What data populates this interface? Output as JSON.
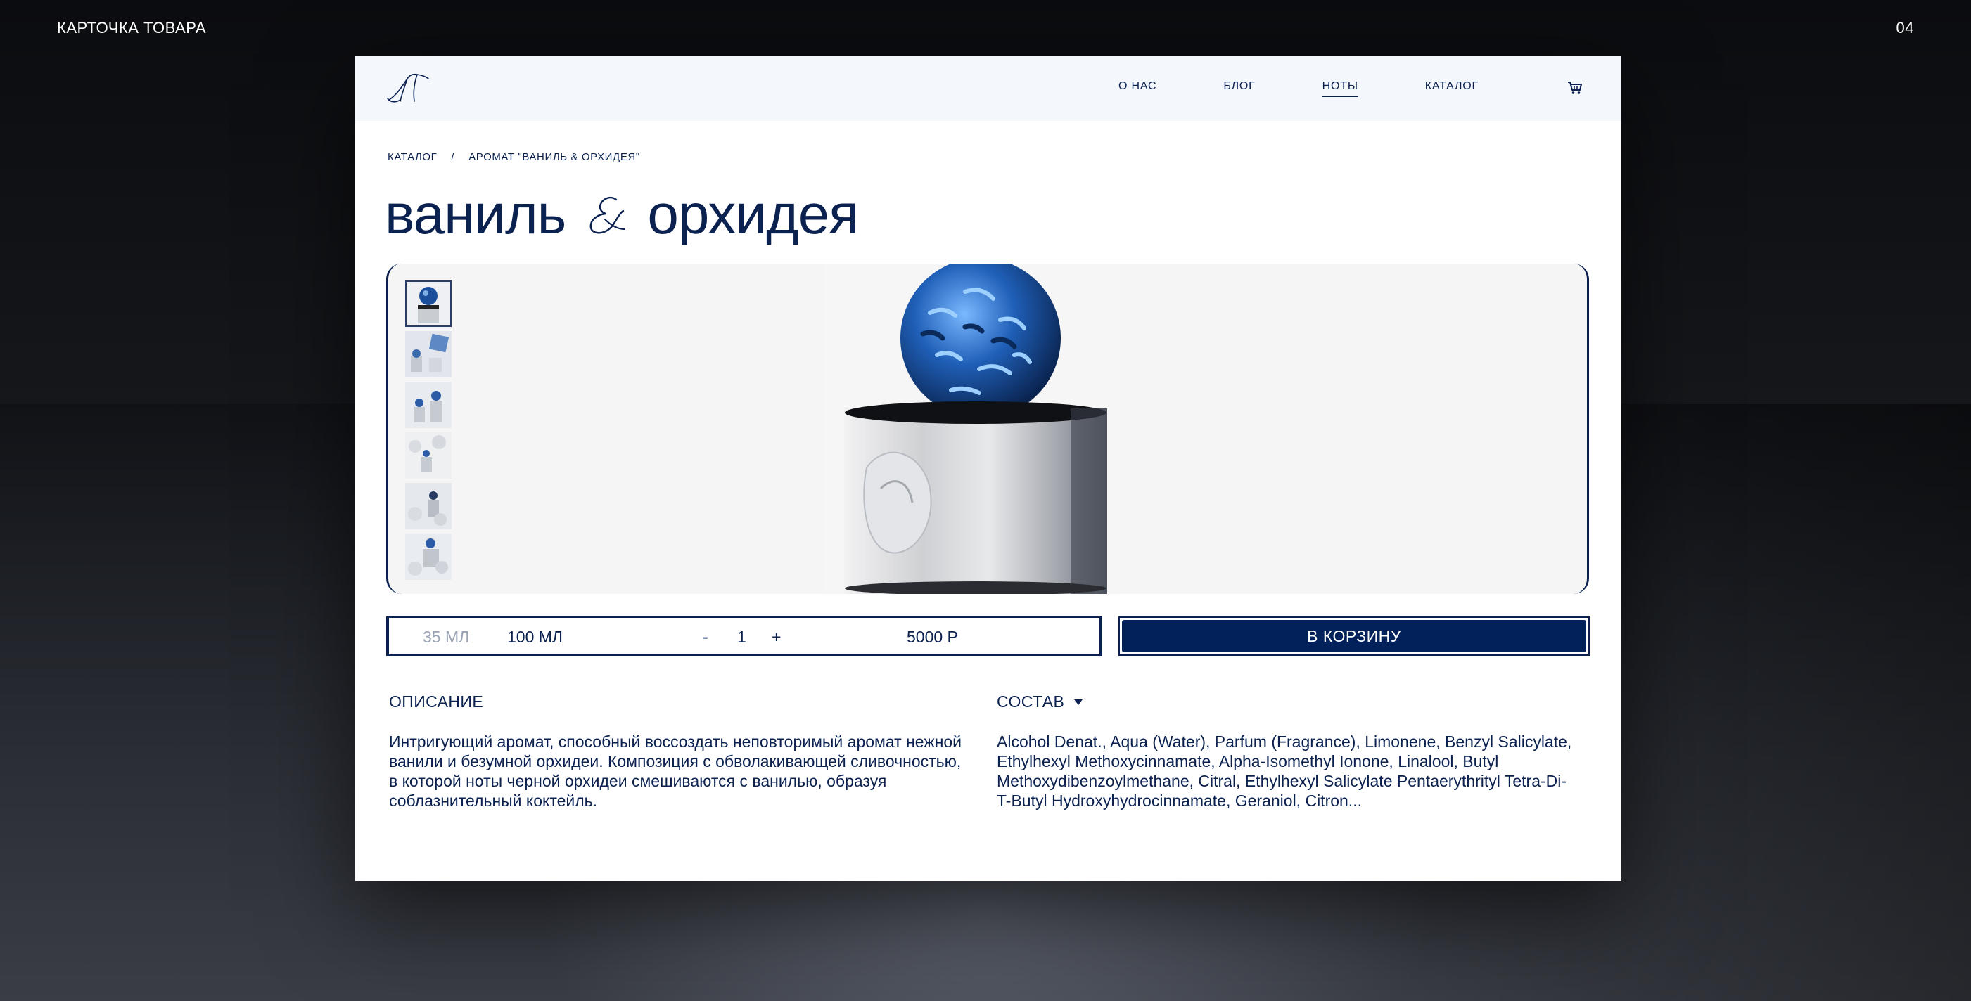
{
  "slide": {
    "title": "КАРТОЧКА ТОВАРА",
    "number": "04"
  },
  "nav": {
    "items": [
      {
        "label": "О НАС",
        "active": false
      },
      {
        "label": "БЛОГ",
        "active": false
      },
      {
        "label": "НОТЫ",
        "active": true
      },
      {
        "label": "КАТАЛОГ",
        "active": false
      }
    ],
    "cart_icon": "cart-icon",
    "logo_icon": "script-logo-icon"
  },
  "breadcrumb": {
    "root": "КАТАЛОГ",
    "separator": "/",
    "current": "АРОМАТ \"ВАНИЛЬ & ОРХИДЕЯ\""
  },
  "product": {
    "title_left": "ваниль",
    "title_right": "орхидея",
    "ampersand_icon": "script-ampersand-icon"
  },
  "gallery": {
    "thumbnail_count": 6,
    "active_thumbnail": 1
  },
  "options": {
    "volumes": [
      {
        "label": "35 МЛ",
        "selected": false
      },
      {
        "label": "100 МЛ",
        "selected": true
      }
    ],
    "minus": "-",
    "quantity": "1",
    "plus": "+",
    "price": "5000 Р"
  },
  "actions": {
    "add_to_cart": "В КОРЗИНУ"
  },
  "description": {
    "heading": "ОПИСАНИЕ",
    "text": "Интригующий аромат, способный воссоздать неповторимый аромат нежной ванили и безумной орхидеи. Композиция с обволакивающей сливочностью, в которой ноты черной орхидеи смешиваются с ванилью, образуя соблазнительный коктейль."
  },
  "composition": {
    "heading": "СОСТАВ",
    "text": "Alcohol Denat., Aqua (Water), Parfum (Fragrance), Limonene, Benzyl Salicylate, Ethylhexyl Methoxycinnamate, Alpha-Isomethyl Ionone, Linalool, Butyl Methoxydibenzoylmethane, Citral, Ethylhexyl Salicylate Pentaerythrityl Tetra-Di-T-Butyl Hydroxyhydrocinnamate, Geraniol, Citron..."
  },
  "colors": {
    "brand": "#0b2150",
    "button": "#02205a",
    "nav_bg": "#f4f7fc",
    "muted": "#9aa3b3"
  }
}
